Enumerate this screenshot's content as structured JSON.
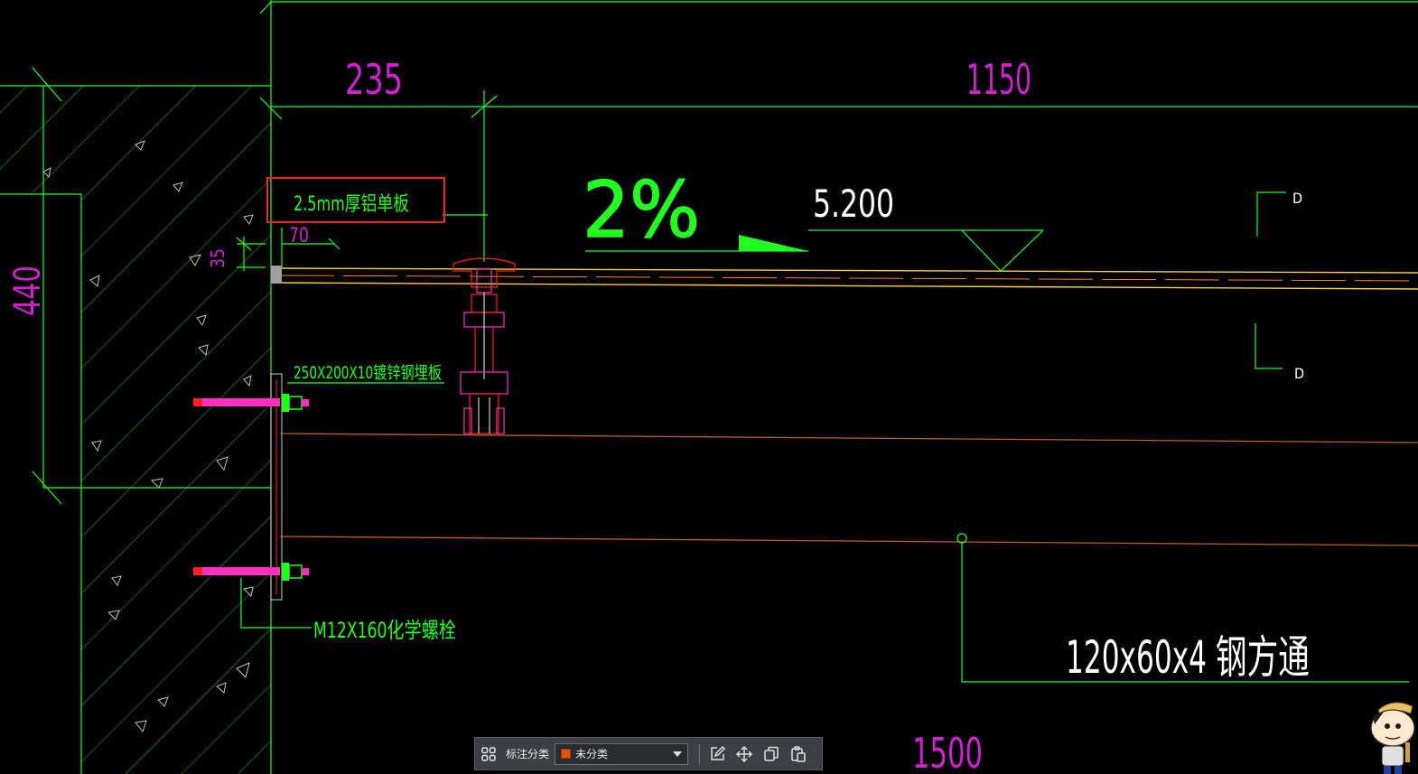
{
  "drawing": {
    "dimensions": {
      "d235": "235",
      "d1150": "1150",
      "d440": "440",
      "d70": "70",
      "d35": "35",
      "d1500": "1500"
    },
    "slope": {
      "percent": "2%",
      "elevation": "5.200"
    },
    "section_mark": {
      "top": "D",
      "bottom": "D"
    },
    "annotations": {
      "panel": "2.5mm厚铝单板",
      "plate": "250X200X10镀锌钢埋板",
      "bolt": "M12X160化学螺栓",
      "tube": "120x60x4 钢方通"
    },
    "colors": {
      "background": "#000000",
      "line_green": "#20ff20",
      "dimension_magenta": "#d020d0",
      "highlight_red": "#ff2020"
    }
  },
  "toolbar": {
    "grid_icon": "grid-icon",
    "category_label": "标注分类",
    "category_value": "未分类",
    "category_color": "#e05010",
    "edit_icon": "edit-icon",
    "move_icon": "move-icon",
    "copy_icon": "copy-icon",
    "paste_icon": "paste-icon"
  }
}
